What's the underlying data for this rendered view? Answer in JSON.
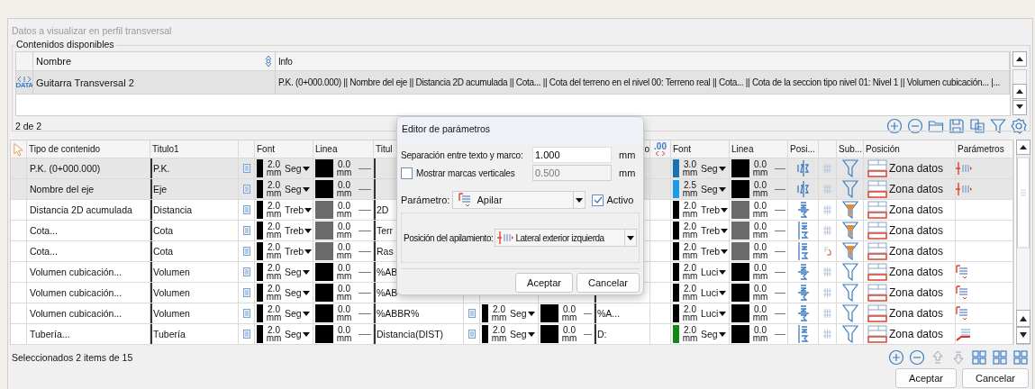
{
  "window": {
    "title": "Datos a visualizar en perfil transversal"
  },
  "available": {
    "label": "Contenidos disponibles",
    "columns": [
      "Nombre",
      "Info"
    ],
    "rows": [
      {
        "selected": true,
        "icon_label": "DATA",
        "name": "Guitarra Transversal 2",
        "info": "P.K. (0+000.000) || Nombre del eje || Distancia 2D acumulada || Cota... || Cota del terreno en el nivel 00: Terreno real || Cota... || Cota de la seccion tipo nivel 01: Nivel 1 || Volumen cubicación... |..."
      }
    ],
    "count": "2 de 2"
  },
  "content_table": {
    "header": {
      "tipo": "Tipo de contenido",
      "titulo1": "Titulo1",
      "font1": "Font",
      "line1": "Linea",
      "titulo2": "Titul",
      "titulo3": "o",
      "decimals": ".00",
      "font3": "Font",
      "line3": "Linea",
      "posi": "Posi...",
      "sub": "Sub...",
      "posicion": "Posición",
      "param": "Parámetros"
    },
    "rows": [
      {
        "selected": true,
        "tipo": "P.K. (0+000.000)",
        "titulo1": "P.K.",
        "font1": {
          "color": "#000000",
          "size": "2.0 mm",
          "face": "Seg"
        },
        "line1": {
          "color": "#000000",
          "width": "0.0 mm"
        },
        "font3": {
          "color": "#1a72b0",
          "size": "3.0 mm",
          "face": "Seg"
        },
        "line3": {
          "color": "#000000",
          "width": "0.0 mm"
        },
        "posi": {
          "kind": "crossed"
        },
        "grid": {
          "kind": "grid"
        },
        "filter": {
          "kind": "outline"
        },
        "posicion": "Zona datos",
        "param": {
          "kind": "marks"
        }
      },
      {
        "selected": true,
        "tipo": "Nombre del eje",
        "titulo1": "Eje",
        "font1": {
          "color": "#000000",
          "size": "2.0 mm",
          "face": "Seg"
        },
        "line1": {
          "color": "#000000",
          "width": "0.0 mm"
        },
        "font3": {
          "color": "#1e9be6",
          "size": "2.5 mm",
          "face": "Seg"
        },
        "line3": {
          "color": "#000000",
          "width": "0.0 mm"
        },
        "posi": {
          "kind": "crossed"
        },
        "grid": {
          "kind": "grid"
        },
        "filter": {
          "kind": "outline"
        },
        "posicion": "Zona datos",
        "param": {
          "kind": "marks"
        }
      },
      {
        "selected": false,
        "tipo": "Distancia 2D acumulada",
        "titulo1": "Distancia",
        "font1": {
          "color": "#000000",
          "size": "2.0 mm",
          "face": "Treb"
        },
        "line1": {
          "color": "#6b6b6b",
          "width": "0.0 mm"
        },
        "titulo2": "2D",
        "font3": {
          "color": "#000000",
          "size": "2.0 mm",
          "face": "Treb"
        },
        "line3": {
          "color": "#6b6b6b",
          "width": "0.0 mm"
        },
        "posi": {
          "kind": "rotated"
        },
        "grid": {
          "kind": "grid"
        },
        "filter": {
          "kind": "filled"
        },
        "posicion": "Zona datos"
      },
      {
        "selected": false,
        "tipo": "Cota...",
        "titulo1": "Cota",
        "font1": {
          "color": "#000000",
          "size": "2.0 mm",
          "face": "Treb"
        },
        "line1": {
          "color": "#6b6b6b",
          "width": "0.0 mm"
        },
        "titulo2": "Terr",
        "font3": {
          "color": "#000000",
          "size": "2.0 mm",
          "face": "Treb"
        },
        "line3": {
          "color": "#6b6b6b",
          "width": "0.0 mm"
        },
        "posi": {
          "kind": "bar"
        },
        "grid": {
          "kind": "grid"
        },
        "filter": {
          "kind": "filled"
        },
        "posicion": "Zona datos"
      },
      {
        "selected": false,
        "tipo": "Cota...",
        "titulo1": "Cota",
        "font1": {
          "color": "#000000",
          "size": "2.0 mm",
          "face": "Treb"
        },
        "line1": {
          "color": "#6b6b6b",
          "width": "0.0 mm"
        },
        "titulo2": "Ras",
        "font3": {
          "color": "#000000",
          "size": "2.0 mm",
          "face": "Treb"
        },
        "line3": {
          "color": "#6b6b6b",
          "width": "0.0 mm"
        },
        "posi": {
          "kind": "bar"
        },
        "grid": {
          "kind": "arrow"
        },
        "filter": {
          "kind": "filled"
        },
        "posicion": "Zona datos"
      },
      {
        "selected": false,
        "tipo": "Volumen cubicación...",
        "titulo1": "Volumen",
        "font1": {
          "color": "#000000",
          "size": "2.0 mm",
          "face": "Seg"
        },
        "line1": {
          "color": "#000000",
          "width": "0.0 mm"
        },
        "titulo2": "%AB",
        "font3": {
          "color": "#000000",
          "size": "2.0 mm",
          "face": "Luci"
        },
        "line3": {
          "color": "#000000",
          "width": "0.0 mm"
        },
        "posi": {
          "kind": "rotated"
        },
        "grid": {
          "kind": "grid"
        },
        "filter": {
          "kind": "outline"
        },
        "posicion": "Zona datos",
        "param": {
          "kind": "stack"
        }
      },
      {
        "selected": false,
        "tipo": "Volumen cubicación...",
        "titulo1": "Volumen",
        "font1": {
          "color": "#000000",
          "size": "2.0 mm",
          "face": "Seg"
        },
        "line1": {
          "color": "#000000",
          "width": "0.0 mm"
        },
        "titulo2": "%AB",
        "font3": {
          "color": "#000000",
          "size": "2.0 mm",
          "face": "Luci"
        },
        "line3": {
          "color": "#000000",
          "width": "0.0 mm"
        },
        "posi": {
          "kind": "rotated"
        },
        "grid": {
          "kind": "grid"
        },
        "filter": {
          "kind": "outline"
        },
        "posicion": "Zona datos",
        "param": {
          "kind": "stack"
        }
      },
      {
        "selected": false,
        "tipo": "Volumen cubicación...",
        "titulo1": "Volumen",
        "font1": {
          "color": "#000000",
          "size": "2.0 mm",
          "face": "Seg"
        },
        "line1": {
          "color": "#000000",
          "width": "0.0 mm"
        },
        "titulo2": "%ABBR%",
        "mid": {
          "font2": {
            "color": "#000000",
            "size": "2.0 mm",
            "face": "Seg"
          },
          "line2": {
            "color": "#000000",
            "width": "0.0 mm"
          },
          "titulo3": "%A..."
        },
        "font3": {
          "color": "#000000",
          "size": "2.0 mm",
          "face": "Luci"
        },
        "line3": {
          "color": "#000000",
          "width": "0.0 mm"
        },
        "posi": {
          "kind": "rotated"
        },
        "grid": {
          "kind": "grid"
        },
        "filter": {
          "kind": "outline"
        },
        "posicion": "Zona datos",
        "param": {
          "kind": "stack"
        }
      },
      {
        "selected": false,
        "tipo": "Tubería...",
        "titulo1": "Tubería",
        "font1": {
          "color": "#000000",
          "size": "2.0 mm",
          "face": "Seg"
        },
        "line1": {
          "color": "#000000",
          "width": "0.0 mm"
        },
        "titulo2": "Distancia(DIST)",
        "mid": {
          "font2": {
            "color": "#000000",
            "size": "2.0 mm",
            "face": "Seg"
          },
          "line2": {
            "color": "#000000",
            "width": "0.0 mm"
          },
          "titulo3": "D:"
        },
        "font3": {
          "color": "#108a10",
          "size": "2.0 mm",
          "face": "Seg"
        },
        "line3": {
          "color": "#000000",
          "width": "0.0 mm"
        },
        "posi": {
          "kind": "bar"
        },
        "grid": {
          "kind": "grid"
        },
        "filter": {
          "kind": "outline"
        },
        "posicion": "Zona datos",
        "param": {
          "kind": "corner"
        }
      }
    ]
  },
  "dialog": {
    "title": "Editor de parámetros",
    "separation": {
      "label": "Separación entre texto y marco:",
      "value": "1.000",
      "unit": "mm"
    },
    "marks": {
      "label": "Mostrar marcas verticales",
      "checked": false,
      "value": "0.500",
      "unit": "mm",
      "disabled": true
    },
    "parameter": {
      "label": "Parámetro:",
      "value": "Apilar"
    },
    "active": {
      "label": "Activo",
      "checked": true
    },
    "stack_position": {
      "label": "Posición del apilamiento:",
      "value": "Lateral exterior izquierda"
    },
    "buttons": [
      "Aceptar",
      "Cancelar"
    ]
  },
  "status": "Seleccionados 2 items de 15",
  "buttons": [
    "Aceptar",
    "Cancelar"
  ]
}
